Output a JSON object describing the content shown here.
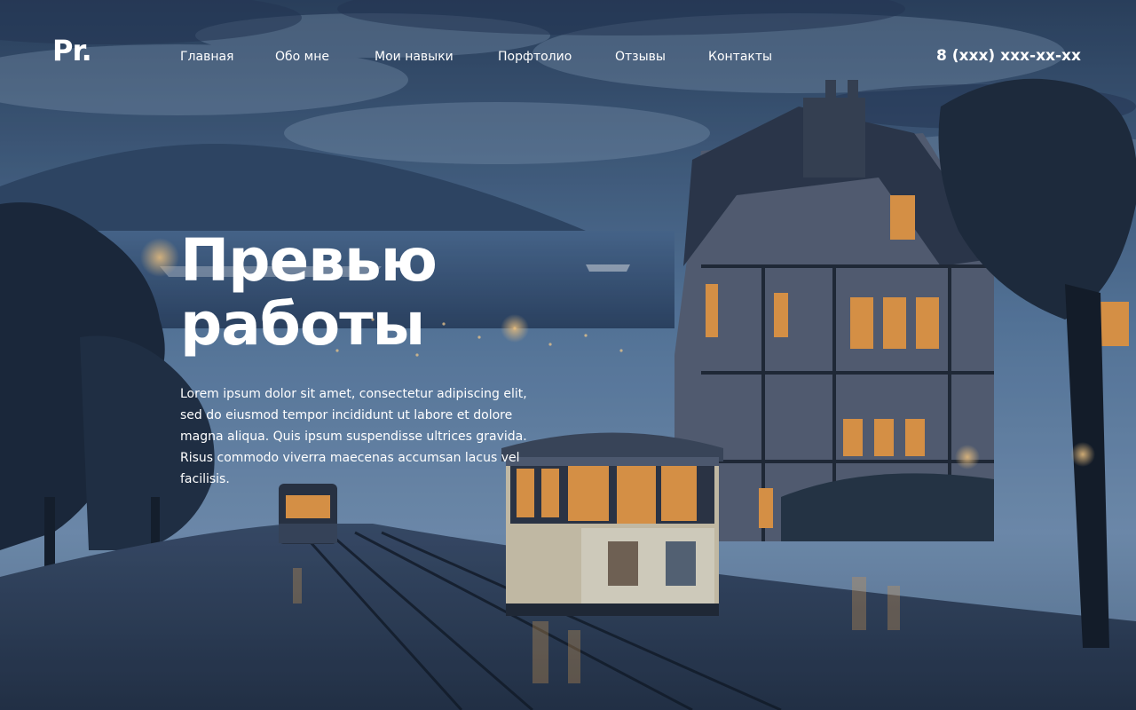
{
  "header": {
    "logo": "Pr.",
    "nav": [
      {
        "label": "Главная"
      },
      {
        "label": "Обо мне"
      },
      {
        "label": "Мои навыки"
      },
      {
        "label": "Порфтолио"
      },
      {
        "label": "Отзывы"
      },
      {
        "label": "Контакты"
      }
    ],
    "phone": "8 (xxx) xxx-xx-xx"
  },
  "hero": {
    "title_line1": "Превью",
    "title_line2": "работы",
    "description": "Lorem ipsum dolor sit amet, consectetur adipiscing elit, sed do eiusmod tempor incididunt ut labore et dolore magna aliqua. Quis ipsum suspendisse ultrices gravida. Risus commodo viverra maecenas accumsan lacus vel facilisis."
  },
  "colors": {
    "text": "#ffffff",
    "sky": "#3d5a80",
    "night": "#1b2536",
    "window_light": "#f0a04b"
  }
}
